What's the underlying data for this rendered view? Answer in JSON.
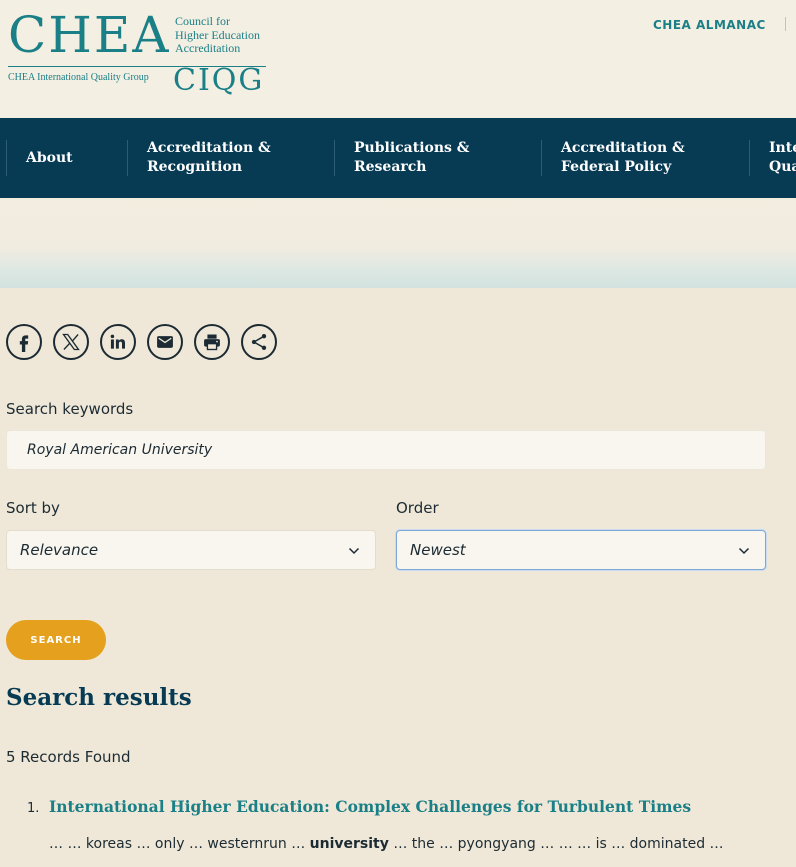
{
  "header": {
    "logo": {
      "chea": "CHEA",
      "council_line1": "Council for",
      "council_line2": "Higher Education",
      "council_line3": "Accreditation",
      "intl": "CHEA International Quality Group",
      "ciqg": "CIQG"
    },
    "utility_link": "CHEA ALMANAC"
  },
  "nav": {
    "items": [
      {
        "label": "About"
      },
      {
        "label": "Accreditation &\nRecognition"
      },
      {
        "label": "Publications &\nResearch"
      },
      {
        "label": "Accreditation &\nFederal Policy"
      },
      {
        "label": "Inte\nQua"
      }
    ]
  },
  "share": {
    "icons": [
      "facebook-icon",
      "x-icon",
      "linkedin-icon",
      "email-icon",
      "print-icon",
      "share-icon"
    ]
  },
  "search_form": {
    "keywords_label": "Search keywords",
    "keywords_value": "Royal American University",
    "sort_label": "Sort by",
    "sort_value": "Relevance",
    "order_label": "Order",
    "order_value": "Newest",
    "submit_label": "SEARCH"
  },
  "results": {
    "title": "Search results",
    "count_text": "5 Records Found",
    "items": [
      {
        "number": "1.",
        "title": "International Higher Education: Complex Challenges for Turbulent Times",
        "snippet_before": "… … koreas … only … westernrun … ",
        "snippet_highlight": "university",
        "snippet_after": " … the … pyongyang … … … is … dominated …"
      }
    ]
  },
  "colors": {
    "page_bg": "#efe8d8",
    "nav_bg": "#073b54",
    "teal": "#1a7f86",
    "button": "#e5a11d"
  }
}
